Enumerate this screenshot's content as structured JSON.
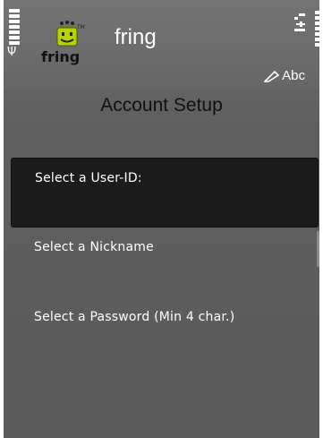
{
  "app": {
    "title": "fring",
    "logo_text": "fring",
    "logo_tm": "TM"
  },
  "status": {
    "signal_icon": "signal-strength-icon",
    "battery_icon": "battery-icon",
    "input_mode": "Abc"
  },
  "header": {
    "title": "Account Setup"
  },
  "fields": [
    {
      "label": "Select a User-ID:"
    },
    {
      "label": "Select a Nickname"
    },
    {
      "label": "Select a Password (Min 4 char.)"
    }
  ]
}
